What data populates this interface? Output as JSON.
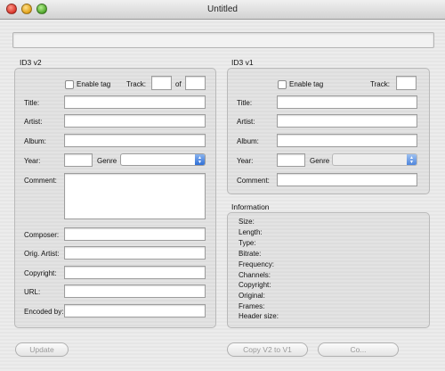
{
  "window": {
    "title": "Untitled"
  },
  "id3v2": {
    "group_label": "ID3 v2",
    "enable_tag_label": "Enable tag",
    "track_label": "Track:",
    "of_label": "of",
    "fields": {
      "title": "Title:",
      "artist": "Artist:",
      "album": "Album:",
      "year": "Year:",
      "genre": "Genre",
      "comment": "Comment:",
      "composer": "Composer:",
      "orig_artist": "Orig. Artist:",
      "copyright": "Copyright:",
      "url": "URL:",
      "encoded_by": "Encoded by:"
    }
  },
  "id3v1": {
    "group_label": "ID3 v1",
    "enable_tag_label": "Enable tag",
    "track_label": "Track:",
    "fields": {
      "title": "Title:",
      "artist": "Artist:",
      "album": "Album:",
      "year": "Year:",
      "genre": "Genre",
      "comment": "Comment:"
    }
  },
  "information": {
    "group_label": "Information",
    "items": [
      "Size:",
      "Length:",
      "Type:",
      "Bitrate:",
      "Frequency:",
      "Channels:",
      "Copyright:",
      "Original:",
      "Frames:",
      "Header size:"
    ]
  },
  "buttons": {
    "update": "Update",
    "copy_v2_to_v1": "Copy V2 to V1",
    "copy_v1_to_v2": "Co..."
  }
}
